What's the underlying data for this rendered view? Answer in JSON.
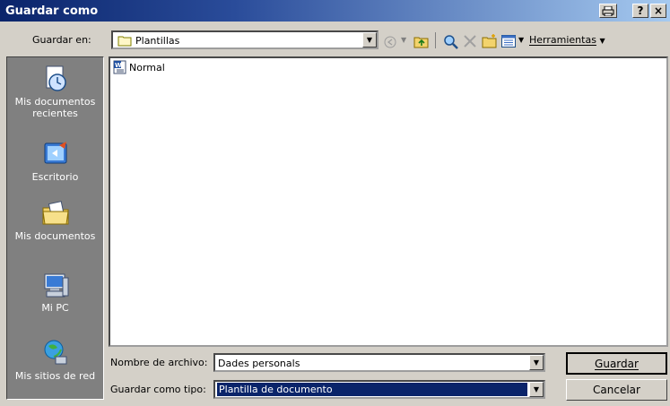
{
  "window": {
    "title": "Guardar como",
    "title_bar_buttons": [
      "?",
      "×"
    ]
  },
  "lookin": {
    "label": "Guardar en:",
    "value": "Plantillas",
    "folder_icon": "folder-icon"
  },
  "toolbar": {
    "tools_label": "Herramientas",
    "tool_icons": [
      "back-icon",
      "up-folder-icon",
      "search-web-icon",
      "delete-icon",
      "new-folder-icon",
      "views-icon"
    ]
  },
  "places": [
    {
      "label_line1": "Mis documentos",
      "label_line2": "recientes",
      "icon": "recent-documents-icon"
    },
    {
      "label_line1": "Escritorio",
      "label_line2": "",
      "icon": "desktop-icon"
    },
    {
      "label_line1": "Mis documentos",
      "label_line2": "",
      "icon": "my-documents-icon"
    },
    {
      "label_line1": "Mi PC",
      "label_line2": "",
      "icon": "my-computer-icon"
    },
    {
      "label_line1": "Mis sitios de red",
      "label_line2": "",
      "icon": "network-places-icon"
    }
  ],
  "files": [
    {
      "name": "Normal",
      "icon": "word-template-icon"
    }
  ],
  "form": {
    "filename_label": "Nombre de archivo:",
    "filename_value": "Dades personals",
    "type_label": "Guardar como tipo:",
    "type_value": "Plantilla de documento"
  },
  "buttons": {
    "save": "Guardar",
    "cancel": "Cancelar"
  },
  "colors": {
    "titlebar_start": "#0a246a",
    "titlebar_end": "#a6caf0",
    "face": "#d4d0c8",
    "places_bg": "#808080",
    "selection": "#0a246a"
  }
}
